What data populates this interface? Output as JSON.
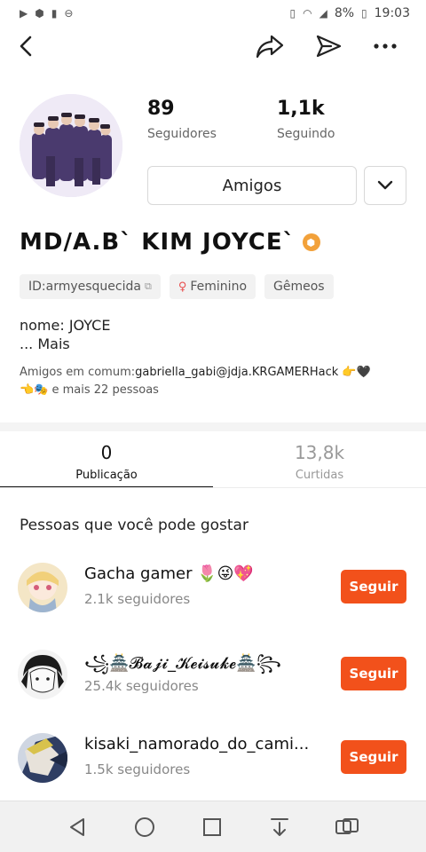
{
  "status_bar": {
    "battery": "8%",
    "time": "19:03"
  },
  "profile": {
    "followers_count": "89",
    "followers_label": "Seguidores",
    "following_count": "1,1k",
    "following_label": "Seguindo",
    "friends_button": "Amigos",
    "name": "MD/A.B` KIM JOYCE`",
    "tags": {
      "id": "ID:armyesquecida",
      "gender": "Feminino",
      "sign": "Gêmeos"
    },
    "bio_line1": "nome: JOYCE",
    "bio_more": "...  Mais",
    "mutual_prefix": "Amigos em comum:",
    "mutual_names": "gabriella_gabi@jdja.KRGAMERHack 👉🖤",
    "mutual_suffix": "👈🎭 e mais 22 pessoas"
  },
  "tabs": [
    {
      "count": "0",
      "label": "Publicação"
    },
    {
      "count": "13,8k",
      "label": "Curtidas"
    }
  ],
  "suggestions": {
    "title": "Pessoas que você pode gostar",
    "follow_label": "Seguir",
    "people": [
      {
        "name": "Gacha gamer 🌷😜💖",
        "followers": "2.1k seguidores"
      },
      {
        "name": "꧁🏯𝓑𝓪𝓳𝓲_𝓚𝓮𝓲𝓼𝓾𝓴𝓮🏯꧂",
        "followers": "25.4k seguidores"
      },
      {
        "name": "kisaki_namorado_do_cami...",
        "followers": "1.5k seguidores"
      }
    ]
  },
  "colors": {
    "accent": "#f2511b",
    "tab_active": "#111111",
    "tab_inactive": "#999999"
  }
}
